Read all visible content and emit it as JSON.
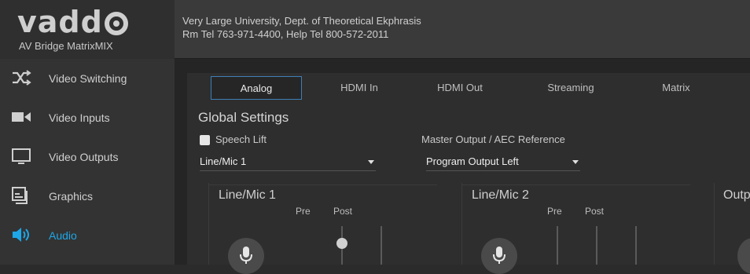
{
  "header": {
    "brand_text": "vadd",
    "product_name": "AV Bridge MatrixMIX",
    "org_line1": "Very Large University, Dept. of Theoretical Ekphrasis",
    "org_line2": "Rm Tel 763-971-4400, Help Tel 800-572-2011"
  },
  "sidebar": {
    "items": [
      {
        "label": "Video Switching",
        "icon": "shuffle-icon"
      },
      {
        "label": "Video Inputs",
        "icon": "video-camera-icon"
      },
      {
        "label": "Video Outputs",
        "icon": "monitor-icon"
      },
      {
        "label": "Graphics",
        "icon": "graphics-icon"
      },
      {
        "label": "Audio",
        "icon": "speaker-icon",
        "active": true
      }
    ]
  },
  "tabs": [
    {
      "label": "Analog",
      "active": true
    },
    {
      "label": "HDMI In"
    },
    {
      "label": "HDMI Out"
    },
    {
      "label": "Streaming"
    },
    {
      "label": "Matrix"
    }
  ],
  "global": {
    "title": "Global Settings",
    "speech_lift_label": "Speech Lift",
    "speech_lift_checked": false,
    "speech_lift_source": "Line/Mic 1",
    "aec_label": "Master Output / AEC Reference",
    "aec_value": "Program Output Left"
  },
  "channels": [
    {
      "title": "Line/Mic 1",
      "pre": "Pre",
      "post": "Post"
    },
    {
      "title": "Line/Mic 2",
      "pre": "Pre",
      "post": "Post"
    },
    {
      "title": "Outp"
    }
  ],
  "colors": {
    "accent": "#1ea7e8",
    "tab_border": "#3f7fb5"
  }
}
